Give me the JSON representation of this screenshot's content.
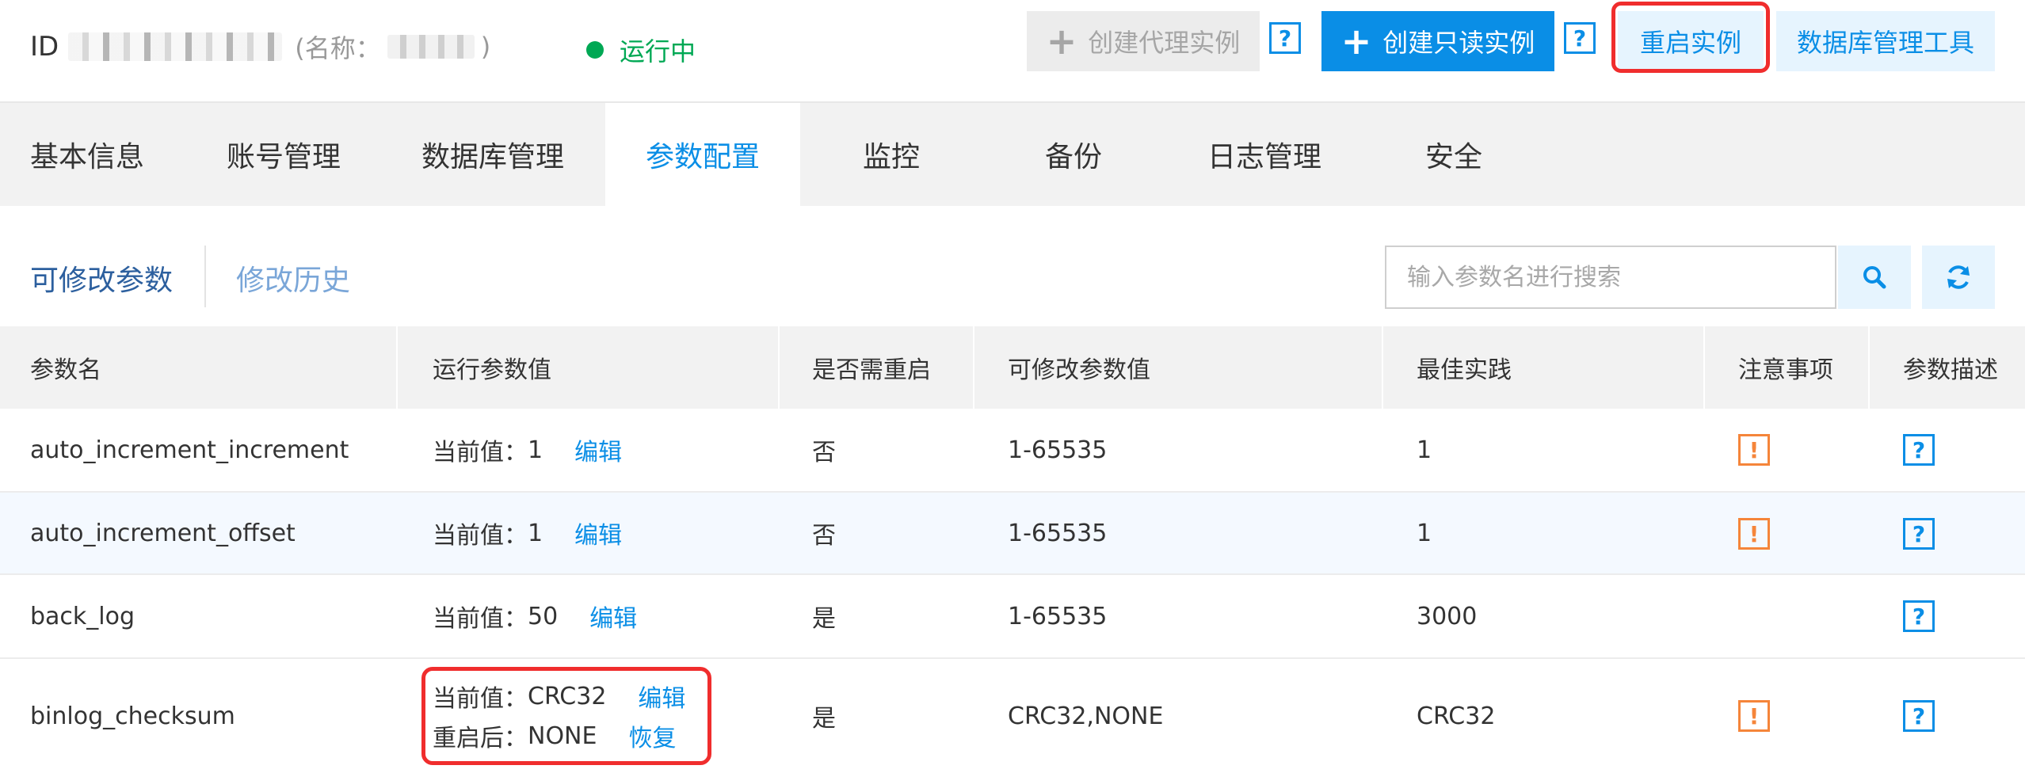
{
  "header": {
    "id_label": "ID",
    "name_prefix": "(名称：",
    "name_suffix": ")",
    "status": "运行中",
    "buttons": {
      "proxy": "创建代理实例",
      "readonly": "创建只读实例",
      "restart": "重启实例",
      "db_tool": "数据库管理工具"
    },
    "help_glyph": "?"
  },
  "tabs": [
    "基本信息",
    "账号管理",
    "数据库管理",
    "参数配置",
    "监控",
    "备份",
    "日志管理",
    "安全"
  ],
  "active_tab": "参数配置",
  "subtabs": {
    "editable": "可修改参数",
    "history": "修改历史"
  },
  "search": {
    "placeholder": "输入参数名进行搜索",
    "value": ""
  },
  "table": {
    "columns": [
      "参数名",
      "运行参数值",
      "是否需重启",
      "可修改参数值",
      "最佳实践",
      "注意事项",
      "参数描述"
    ],
    "current_prefix": "当前值：",
    "after_restart_prefix": "重启后：",
    "edit": "编辑",
    "restore": "恢复",
    "warn_glyph": "!",
    "help_glyph": "?",
    "rows": [
      {
        "name": "auto_increment_increment",
        "current": "1",
        "restart": "否",
        "range": "1-65535",
        "best": "1",
        "has_warning": true
      },
      {
        "name": "auto_increment_offset",
        "current": "1",
        "restart": "否",
        "range": "1-65535",
        "best": "1",
        "has_warning": true
      },
      {
        "name": "back_log",
        "current": "50",
        "restart": "是",
        "range": "1-65535",
        "best": "3000",
        "has_warning": false
      },
      {
        "name": "binlog_checksum",
        "current": "CRC32",
        "after_restart": "NONE",
        "restart": "是",
        "range": "CRC32,NONE",
        "best": "CRC32",
        "has_warning": true
      }
    ]
  },
  "colors": {
    "accent": "#0a8ee6",
    "running": "#00a854",
    "warning": "#f5853a",
    "highlight": "#f02d2d"
  }
}
